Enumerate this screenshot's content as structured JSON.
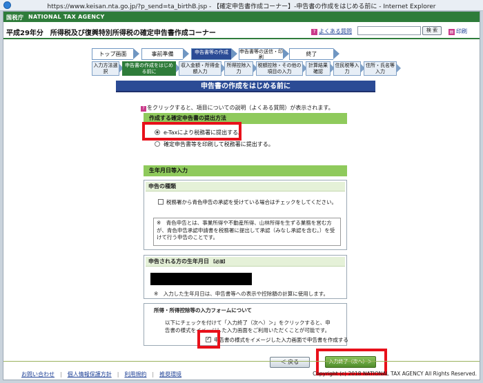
{
  "window": {
    "title": "https://www.keisan.nta.go.jp/?p_send=ta_birthB.jsp - 【確定申告書作成コーナー】-申告書の作成をはじめる前に - Internet Explorer"
  },
  "nta": {
    "logo": "国税庁",
    "agency": "NATIONAL TAX AGENCY"
  },
  "header": {
    "heading": "平成29年分　所得税及び復興特別所得税の確定申告書作成コーナー",
    "faq_label": "よくある質問",
    "search_placeholder": "",
    "search_button": "検 索",
    "guide_label": "印刷"
  },
  "steps_main": [
    {
      "label": "トップ画面"
    },
    {
      "label": "事前準備"
    },
    {
      "label": "申告書等の作成"
    },
    {
      "label": "申告書等の送信・印刷"
    },
    {
      "label": "終了"
    }
  ],
  "steps_sub": [
    {
      "label": "入力方法選択"
    },
    {
      "label": "申告書の作成をはじめる前に"
    },
    {
      "label": "収入金額・所得金額入力"
    },
    {
      "label": "所得控除入力"
    },
    {
      "label": "税額控除・その他の項目の入力"
    },
    {
      "label": "計算結果確認"
    },
    {
      "label": "住民税等入力"
    },
    {
      "label": "住所・氏名等入力"
    }
  ],
  "main": {
    "section_title": "申告書の作成をはじめる前に",
    "help_note": "をクリックすると、項目についての説明（よくある質問）が表示されます。",
    "submission": {
      "heading": "作成する確定申告書の提出方法",
      "option_etax": "e-Taxにより税務署に提出する。",
      "option_print": "確定申告書等を印刷して税務署に提出する。"
    },
    "birth": {
      "heading": "生年月日等入力",
      "type_heading": "申告の種類",
      "blue_check_label": "税務署から青色申告の承認を受けている場合はチェックをしてください。",
      "note": "※　青色申告とは、事業所得や不動産所得、山林所得を生ずる業務を営む方が、青色申告承認申請書を税務署に提出して承認（みなし承認を含む。）を受けて行う申告のことです。",
      "dob_heading": "申告される方の生年月日",
      "required": "必須",
      "dob_note": "※　入力した生年月日は、申告書等への表示や控除額の計算に使用します。"
    },
    "form_about": {
      "heading": "所得・所得控除等の入力フォームについて",
      "desc_line1": "以下にチェックを付けて「入力終了（次へ）＞」をクリックすると、申",
      "desc_line2": "告書の様式をイメージした入力画面をご利用いただくことが可能です。",
      "check_label": "申告書の様式をイメージした入力画面で申告書を作成する"
    },
    "back_button": "＜ 戻る",
    "next_button": "入力終了（次へ）＞"
  },
  "footer": {
    "links": [
      "お問い合わせ",
      "個人情報保護方針",
      "利用規約",
      "推奨環境"
    ],
    "copyright": "Copyright (c) 2018 NATIONAL TAX AGENCY All Rights Reserved."
  }
}
